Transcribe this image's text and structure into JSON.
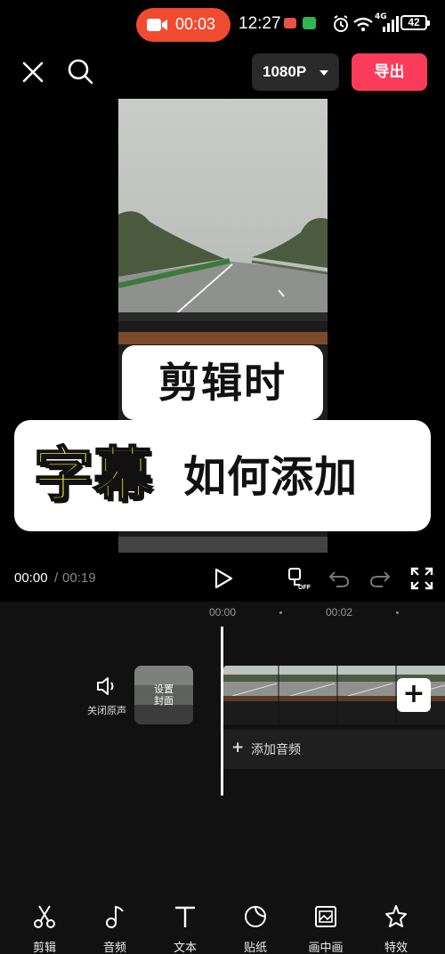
{
  "status_bar": {
    "recording_time": "00:03",
    "clock": "12:27",
    "network_label": "4G",
    "battery": "42"
  },
  "top_bar": {
    "resolution": "1080P",
    "export_label": "导出"
  },
  "preview": {
    "caption_line1": "剪辑时",
    "caption_highlight": "字幕",
    "caption_rest": "如何添加"
  },
  "playback": {
    "current_time": "00:00",
    "separator": "/",
    "total_time": "00:19"
  },
  "timeline": {
    "ruler": [
      "00:00",
      "00:02"
    ],
    "mute_label": "关闭原声",
    "cover_label_1": "设置",
    "cover_label_2": "封面",
    "add_audio_label": "添加音频"
  },
  "toolbar": {
    "items": [
      {
        "label": "剪辑",
        "icon": "scissors-icon"
      },
      {
        "label": "音频",
        "icon": "music-note-icon"
      },
      {
        "label": "文本",
        "icon": "text-icon"
      },
      {
        "label": "贴纸",
        "icon": "sticker-icon"
      },
      {
        "label": "画中画",
        "icon": "picture-in-picture-icon"
      },
      {
        "label": "特效",
        "icon": "effects-star-icon"
      }
    ]
  },
  "colors": {
    "export": "#fa3c5a",
    "recording": "#f04b2e",
    "caption_highlight": "#f4ea1a"
  }
}
